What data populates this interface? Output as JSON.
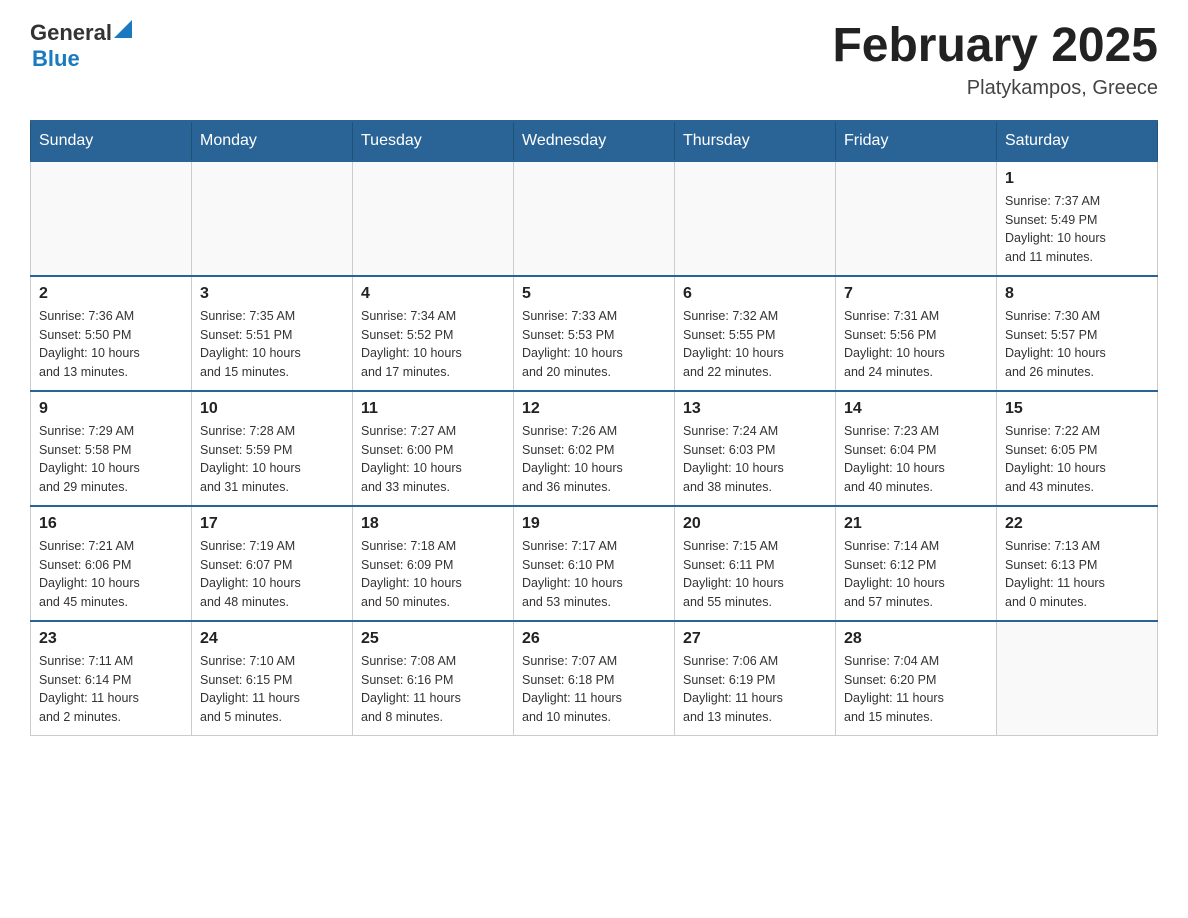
{
  "header": {
    "logo": {
      "general": "General",
      "blue": "Blue"
    },
    "title": "February 2025",
    "location": "Platykampos, Greece"
  },
  "weekdays": [
    "Sunday",
    "Monday",
    "Tuesday",
    "Wednesday",
    "Thursday",
    "Friday",
    "Saturday"
  ],
  "weeks": [
    [
      {
        "day": "",
        "info": ""
      },
      {
        "day": "",
        "info": ""
      },
      {
        "day": "",
        "info": ""
      },
      {
        "day": "",
        "info": ""
      },
      {
        "day": "",
        "info": ""
      },
      {
        "day": "",
        "info": ""
      },
      {
        "day": "1",
        "info": "Sunrise: 7:37 AM\nSunset: 5:49 PM\nDaylight: 10 hours\nand 11 minutes."
      }
    ],
    [
      {
        "day": "2",
        "info": "Sunrise: 7:36 AM\nSunset: 5:50 PM\nDaylight: 10 hours\nand 13 minutes."
      },
      {
        "day": "3",
        "info": "Sunrise: 7:35 AM\nSunset: 5:51 PM\nDaylight: 10 hours\nand 15 minutes."
      },
      {
        "day": "4",
        "info": "Sunrise: 7:34 AM\nSunset: 5:52 PM\nDaylight: 10 hours\nand 17 minutes."
      },
      {
        "day": "5",
        "info": "Sunrise: 7:33 AM\nSunset: 5:53 PM\nDaylight: 10 hours\nand 20 minutes."
      },
      {
        "day": "6",
        "info": "Sunrise: 7:32 AM\nSunset: 5:55 PM\nDaylight: 10 hours\nand 22 minutes."
      },
      {
        "day": "7",
        "info": "Sunrise: 7:31 AM\nSunset: 5:56 PM\nDaylight: 10 hours\nand 24 minutes."
      },
      {
        "day": "8",
        "info": "Sunrise: 7:30 AM\nSunset: 5:57 PM\nDaylight: 10 hours\nand 26 minutes."
      }
    ],
    [
      {
        "day": "9",
        "info": "Sunrise: 7:29 AM\nSunset: 5:58 PM\nDaylight: 10 hours\nand 29 minutes."
      },
      {
        "day": "10",
        "info": "Sunrise: 7:28 AM\nSunset: 5:59 PM\nDaylight: 10 hours\nand 31 minutes."
      },
      {
        "day": "11",
        "info": "Sunrise: 7:27 AM\nSunset: 6:00 PM\nDaylight: 10 hours\nand 33 minutes."
      },
      {
        "day": "12",
        "info": "Sunrise: 7:26 AM\nSunset: 6:02 PM\nDaylight: 10 hours\nand 36 minutes."
      },
      {
        "day": "13",
        "info": "Sunrise: 7:24 AM\nSunset: 6:03 PM\nDaylight: 10 hours\nand 38 minutes."
      },
      {
        "day": "14",
        "info": "Sunrise: 7:23 AM\nSunset: 6:04 PM\nDaylight: 10 hours\nand 40 minutes."
      },
      {
        "day": "15",
        "info": "Sunrise: 7:22 AM\nSunset: 6:05 PM\nDaylight: 10 hours\nand 43 minutes."
      }
    ],
    [
      {
        "day": "16",
        "info": "Sunrise: 7:21 AM\nSunset: 6:06 PM\nDaylight: 10 hours\nand 45 minutes."
      },
      {
        "day": "17",
        "info": "Sunrise: 7:19 AM\nSunset: 6:07 PM\nDaylight: 10 hours\nand 48 minutes."
      },
      {
        "day": "18",
        "info": "Sunrise: 7:18 AM\nSunset: 6:09 PM\nDaylight: 10 hours\nand 50 minutes."
      },
      {
        "day": "19",
        "info": "Sunrise: 7:17 AM\nSunset: 6:10 PM\nDaylight: 10 hours\nand 53 minutes."
      },
      {
        "day": "20",
        "info": "Sunrise: 7:15 AM\nSunset: 6:11 PM\nDaylight: 10 hours\nand 55 minutes."
      },
      {
        "day": "21",
        "info": "Sunrise: 7:14 AM\nSunset: 6:12 PM\nDaylight: 10 hours\nand 57 minutes."
      },
      {
        "day": "22",
        "info": "Sunrise: 7:13 AM\nSunset: 6:13 PM\nDaylight: 11 hours\nand 0 minutes."
      }
    ],
    [
      {
        "day": "23",
        "info": "Sunrise: 7:11 AM\nSunset: 6:14 PM\nDaylight: 11 hours\nand 2 minutes."
      },
      {
        "day": "24",
        "info": "Sunrise: 7:10 AM\nSunset: 6:15 PM\nDaylight: 11 hours\nand 5 minutes."
      },
      {
        "day": "25",
        "info": "Sunrise: 7:08 AM\nSunset: 6:16 PM\nDaylight: 11 hours\nand 8 minutes."
      },
      {
        "day": "26",
        "info": "Sunrise: 7:07 AM\nSunset: 6:18 PM\nDaylight: 11 hours\nand 10 minutes."
      },
      {
        "day": "27",
        "info": "Sunrise: 7:06 AM\nSunset: 6:19 PM\nDaylight: 11 hours\nand 13 minutes."
      },
      {
        "day": "28",
        "info": "Sunrise: 7:04 AM\nSunset: 6:20 PM\nDaylight: 11 hours\nand 15 minutes."
      },
      {
        "day": "",
        "info": ""
      }
    ]
  ]
}
